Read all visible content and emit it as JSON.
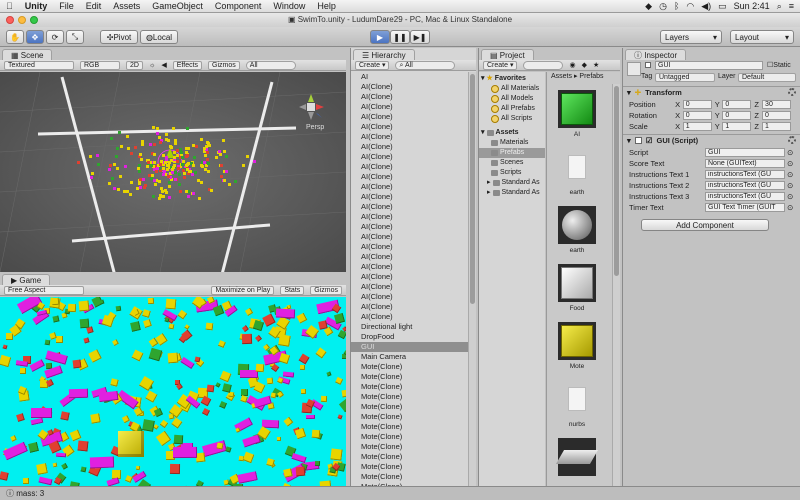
{
  "menubar": {
    "app": "Unity",
    "items": [
      "File",
      "Edit",
      "Assets",
      "GameObject",
      "Component",
      "Window",
      "Help"
    ],
    "clock": "Sun 2:41"
  },
  "window": {
    "title": "SwimTo.unity - LudumDare29 - PC, Mac & Linux Standalone"
  },
  "toolbar": {
    "pivot": "Pivot",
    "local": "Local",
    "layers": "Layers",
    "layout": "Layout"
  },
  "scene": {
    "tab": "Scene",
    "render_mode": "Textured",
    "color_mode": "RGB",
    "mode2d": "2D",
    "effects": "Effects",
    "gizmos": "Gizmos",
    "search_placeholder": "All",
    "persp": "Persp"
  },
  "game": {
    "tab": "Game",
    "aspect": "Free Aspect",
    "maximize": "Maximize on Play",
    "stats": "Stats",
    "gizmos": "Gizmos",
    "background": "#00f0f0"
  },
  "hierarchy": {
    "tab": "Hierarchy",
    "create": "Create",
    "search_placeholder": "All",
    "items": [
      "AI",
      "AI(Clone)",
      "AI(Clone)",
      "AI(Clone)",
      "AI(Clone)",
      "AI(Clone)",
      "AI(Clone)",
      "AI(Clone)",
      "AI(Clone)",
      "AI(Clone)",
      "AI(Clone)",
      "AI(Clone)",
      "AI(Clone)",
      "AI(Clone)",
      "AI(Clone)",
      "AI(Clone)",
      "AI(Clone)",
      "AI(Clone)",
      "AI(Clone)",
      "AI(Clone)",
      "AI(Clone)",
      "AI(Clone)",
      "AI(Clone)",
      "AI(Clone)",
      "AI(Clone)",
      "Directional light",
      "DropFood",
      "GUI",
      "Main Camera",
      "Mote(Clone)",
      "Mote(Clone)",
      "Mote(Clone)",
      "Mote(Clone)",
      "Mote(Clone)",
      "Mote(Clone)",
      "Mote(Clone)",
      "Mote(Clone)",
      "Mote(Clone)",
      "Mote(Clone)",
      "Mote(Clone)",
      "Mote(Clone)",
      "Mote(Clone)"
    ],
    "selected_index": 27
  },
  "project": {
    "tab": "Project",
    "create": "Create",
    "favorites_label": "Favorites",
    "favorites": [
      "All Materials",
      "All Models",
      "All Prefabs",
      "All Scripts"
    ],
    "assets_label": "Assets",
    "folders": [
      "Materials",
      "Prefabs",
      "Scenes",
      "Scripts",
      "Standard As",
      "Standard As"
    ],
    "selected_folder": "Prefabs",
    "breadcrumb": [
      "Assets",
      "Prefabs"
    ],
    "assets": [
      {
        "name": "AI",
        "icon": "green-cube-icon"
      },
      {
        "name": "earth",
        "icon": "document-icon"
      },
      {
        "name": "earth",
        "icon": "grey-sphere-icon"
      },
      {
        "name": "Food",
        "icon": "white-cube-icon"
      },
      {
        "name": "Mote",
        "icon": "yellow-cube-icon"
      },
      {
        "name": "nurbs",
        "icon": "document-icon"
      },
      {
        "name": "",
        "icon": "plane-icon"
      }
    ]
  },
  "inspector": {
    "tab": "Inspector",
    "object_name": "GUI",
    "static_label": "Static",
    "tag_label": "Tag",
    "tag_value": "Untagged",
    "layer_label": "Layer",
    "layer_value": "Default",
    "transform": {
      "title": "Transform",
      "position": {
        "label": "Position",
        "x": "0",
        "y": "0",
        "z": "30"
      },
      "rotation": {
        "label": "Rotation",
        "x": "0",
        "y": "0",
        "z": "0"
      },
      "scale": {
        "label": "Scale",
        "x": "1",
        "y": "1",
        "z": "1"
      }
    },
    "gui_script": {
      "title": "GUI (Script)",
      "fields": [
        {
          "label": "Script",
          "value": "GUI"
        },
        {
          "label": "Score Text",
          "value": "None (GUIText)"
        },
        {
          "label": "Instructions Text 1",
          "value": "instructionsText (GU"
        },
        {
          "label": "Instructions Text 2",
          "value": "instructionsText (GU"
        },
        {
          "label": "Instructions Text 3",
          "value": "instructionsText (GU"
        },
        {
          "label": "Timer Text",
          "value": "GUI Text Timer (GUIT"
        }
      ]
    },
    "add_component": "Add Component"
  },
  "status": {
    "text": "mass: 3"
  },
  "colors": {
    "accent": "#4c74c2",
    "mote": "#e8d400",
    "ai": "#2fa52f",
    "food": "#e020e0"
  }
}
